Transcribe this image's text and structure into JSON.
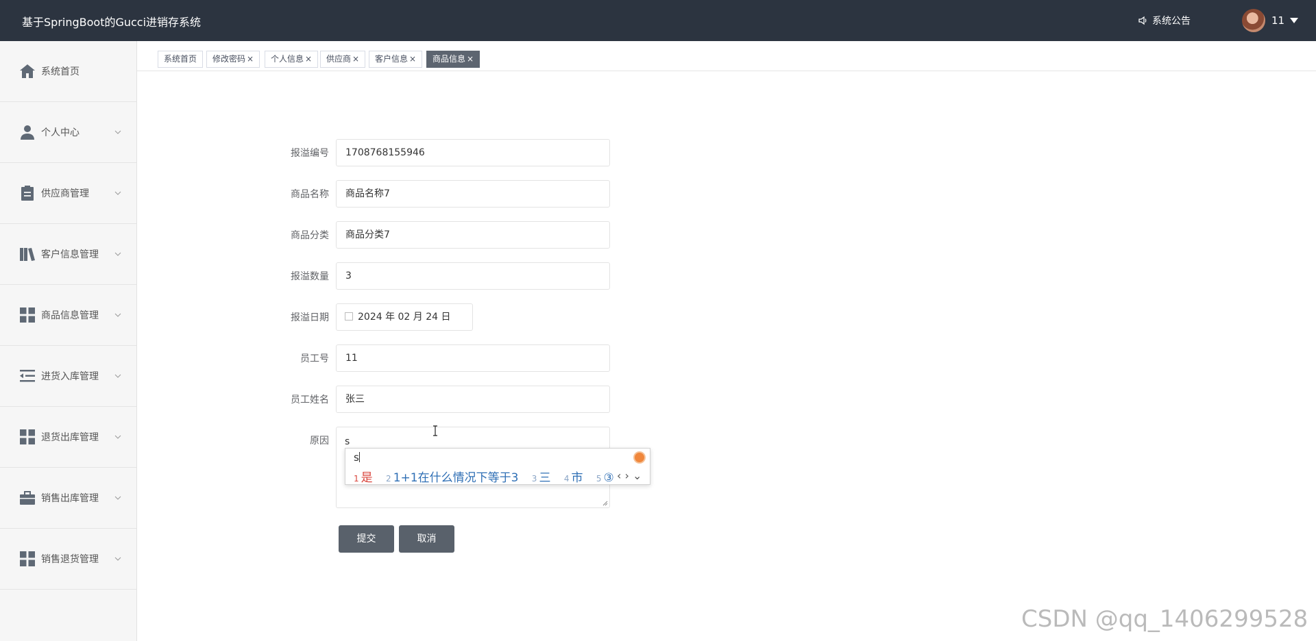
{
  "header": {
    "title": "基于SpringBoot的Gucci进销存系统",
    "notice_label": "系统公告",
    "username": "11"
  },
  "sidebar": {
    "items": [
      {
        "label": "系统首页",
        "icon": "home-icon",
        "expandable": false
      },
      {
        "label": "个人中心",
        "icon": "user-icon",
        "expandable": true
      },
      {
        "label": "供应商管理",
        "icon": "clipboard-icon",
        "expandable": true
      },
      {
        "label": "客户信息管理",
        "icon": "book-icon",
        "expandable": true
      },
      {
        "label": "商品信息管理",
        "icon": "grid-icon",
        "expandable": true
      },
      {
        "label": "进货入库管理",
        "icon": "list-indent-icon",
        "expandable": true
      },
      {
        "label": "退货出库管理",
        "icon": "grid-icon",
        "expandable": true
      },
      {
        "label": "销售出库管理",
        "icon": "briefcase-icon",
        "expandable": true
      },
      {
        "label": "销售退货管理",
        "icon": "grid-icon",
        "expandable": true
      }
    ]
  },
  "tabs": [
    {
      "label": "系统首页",
      "closable": false,
      "active": false
    },
    {
      "label": "修改密码",
      "closable": true,
      "active": false
    },
    {
      "label": "个人信息",
      "closable": true,
      "active": false
    },
    {
      "label": "供应商",
      "closable": true,
      "active": false
    },
    {
      "label": "客户信息",
      "closable": true,
      "active": false
    },
    {
      "label": "商品信息",
      "closable": true,
      "active": true
    }
  ],
  "form": {
    "fields": [
      {
        "label": "报溢编号",
        "value": "1708768155946"
      },
      {
        "label": "商品名称",
        "value": "商品名称7"
      },
      {
        "label": "商品分类",
        "value": "商品分类7"
      },
      {
        "label": "报溢数量",
        "value": "3"
      },
      {
        "label": "报溢日期",
        "value": "2024 年 02 月 24 日"
      },
      {
        "label": "员工号",
        "value": "11"
      },
      {
        "label": "员工姓名",
        "value": "张三"
      }
    ],
    "reason_label": "原因",
    "reason_value": "s",
    "submit_label": "提交",
    "cancel_label": "取消"
  },
  "ime": {
    "composition": "s",
    "candidates": [
      {
        "num": "1",
        "text": "是"
      },
      {
        "num": "2",
        "text": "1+1在什么情况下等于3"
      },
      {
        "num": "3",
        "text": "三"
      },
      {
        "num": "4",
        "text": "市"
      },
      {
        "num": "5",
        "text": "③"
      }
    ],
    "nav": "‹ › ⌄"
  },
  "watermark": "CSDN @qq_1406299528",
  "colors": {
    "header_bg": "#2c3440",
    "sidebar_bg": "#f6f6f6",
    "button_bg": "#59616b",
    "active_tab_bg": "#5d6570"
  }
}
